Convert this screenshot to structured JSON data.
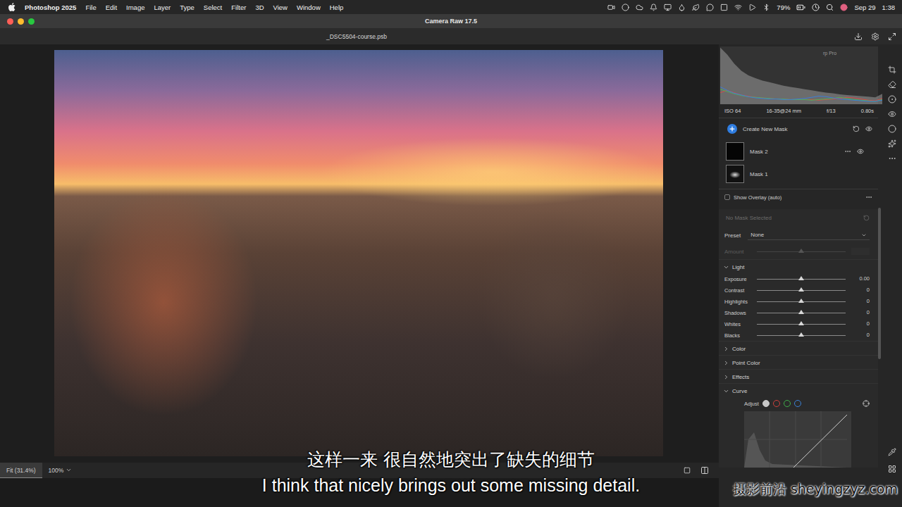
{
  "menu_bar": {
    "app": "Photoshop 2025",
    "items": [
      "File",
      "Edit",
      "Image",
      "Layer",
      "Type",
      "Select",
      "Filter",
      "3D",
      "View",
      "Window",
      "Help"
    ],
    "battery": "79%",
    "date": "Sep 29",
    "time": "1:38"
  },
  "window": {
    "title": "Camera Raw 17.5"
  },
  "document": {
    "name": "_DSC5504-course.psb"
  },
  "zoom": {
    "fit": "Fit (31.4%)",
    "fit_selected": true,
    "level": "100%"
  },
  "histogram": {
    "label": "rp Pro",
    "series": [
      {
        "name": "luminance",
        "color": "#9a9a9a",
        "values": [
          98,
          86,
          70,
          58,
          50,
          45,
          41,
          38,
          35,
          32,
          30,
          28,
          26,
          24,
          22,
          20,
          19,
          17,
          16,
          15,
          14,
          13,
          12,
          18
        ]
      },
      {
        "name": "red",
        "color": "#d64a4a",
        "values": [
          20,
          24,
          20,
          16,
          14,
          12,
          11,
          10,
          9,
          9,
          8,
          8,
          8,
          8,
          7,
          8,
          9,
          10,
          12,
          11,
          9,
          7,
          6,
          10
        ]
      },
      {
        "name": "green",
        "color": "#4fb05a",
        "values": [
          26,
          22,
          18,
          15,
          13,
          12,
          11,
          10,
          9,
          9,
          8,
          8,
          8,
          7,
          8,
          9,
          10,
          12,
          10,
          8,
          7,
          6,
          5,
          8
        ]
      },
      {
        "name": "blue",
        "color": "#3d7fd6",
        "values": [
          30,
          24,
          19,
          16,
          13,
          11,
          10,
          9,
          9,
          8,
          8,
          9,
          10,
          12,
          14,
          13,
          11,
          9,
          8,
          7,
          6,
          5,
          5,
          7
        ]
      }
    ]
  },
  "camera_info": [
    "ISO 64",
    "16-35@24 mm",
    "f/13",
    "0.80s"
  ],
  "create_mask": {
    "label": "Create New Mask"
  },
  "masks": [
    {
      "name": "Mask 2",
      "selected": false,
      "hovered": true
    },
    {
      "name": "Mask 1",
      "selected": false,
      "hovered": false
    }
  ],
  "overlay": {
    "label": "Show Overlay (auto)",
    "checked": false
  },
  "mask_settings": {
    "title": "No Mask Selected",
    "disabled": true,
    "preset_label": "Preset",
    "preset_value": "None",
    "amount_label": "Amount",
    "amount_level": 0.5
  },
  "sections": [
    {
      "title": "Light",
      "expanded": true,
      "sliders": [
        {
          "name": "Exposure",
          "value": "0.00",
          "level": 0.5
        },
        {
          "name": "Contrast",
          "value": "0",
          "level": 0.5
        },
        {
          "name": "Highlights",
          "value": "0",
          "level": 0.5
        },
        {
          "name": "Shadows",
          "value": "0",
          "level": 0.5
        },
        {
          "name": "Whites",
          "value": "0",
          "level": 0.5
        },
        {
          "name": "Blacks",
          "value": "0",
          "level": 0.5
        }
      ]
    },
    {
      "title": "Color",
      "expanded": false,
      "sliders": []
    },
    {
      "title": "Point Color",
      "expanded": false,
      "sliders": []
    },
    {
      "title": "Effects",
      "expanded": false,
      "sliders": []
    },
    {
      "title": "Curve",
      "expanded": true,
      "sliders": []
    }
  ],
  "curve": {
    "adjust_label": "Adjust",
    "channels": [
      {
        "name": "rgb",
        "color": "#c8c8c8",
        "selected": true
      },
      {
        "name": "red",
        "color": "#d0413d",
        "selected": false
      },
      {
        "name": "green",
        "color": "#3fae4a",
        "selected": false
      },
      {
        "name": "blue",
        "color": "#3b82d8",
        "selected": false
      }
    ]
  },
  "subtitles": {
    "zh": "这样一来 很自然地突出了缺失的细节",
    "en": "I think that nicely brings out some missing detail."
  },
  "watermark": "摄影前沿 sheyingzyz.com"
}
